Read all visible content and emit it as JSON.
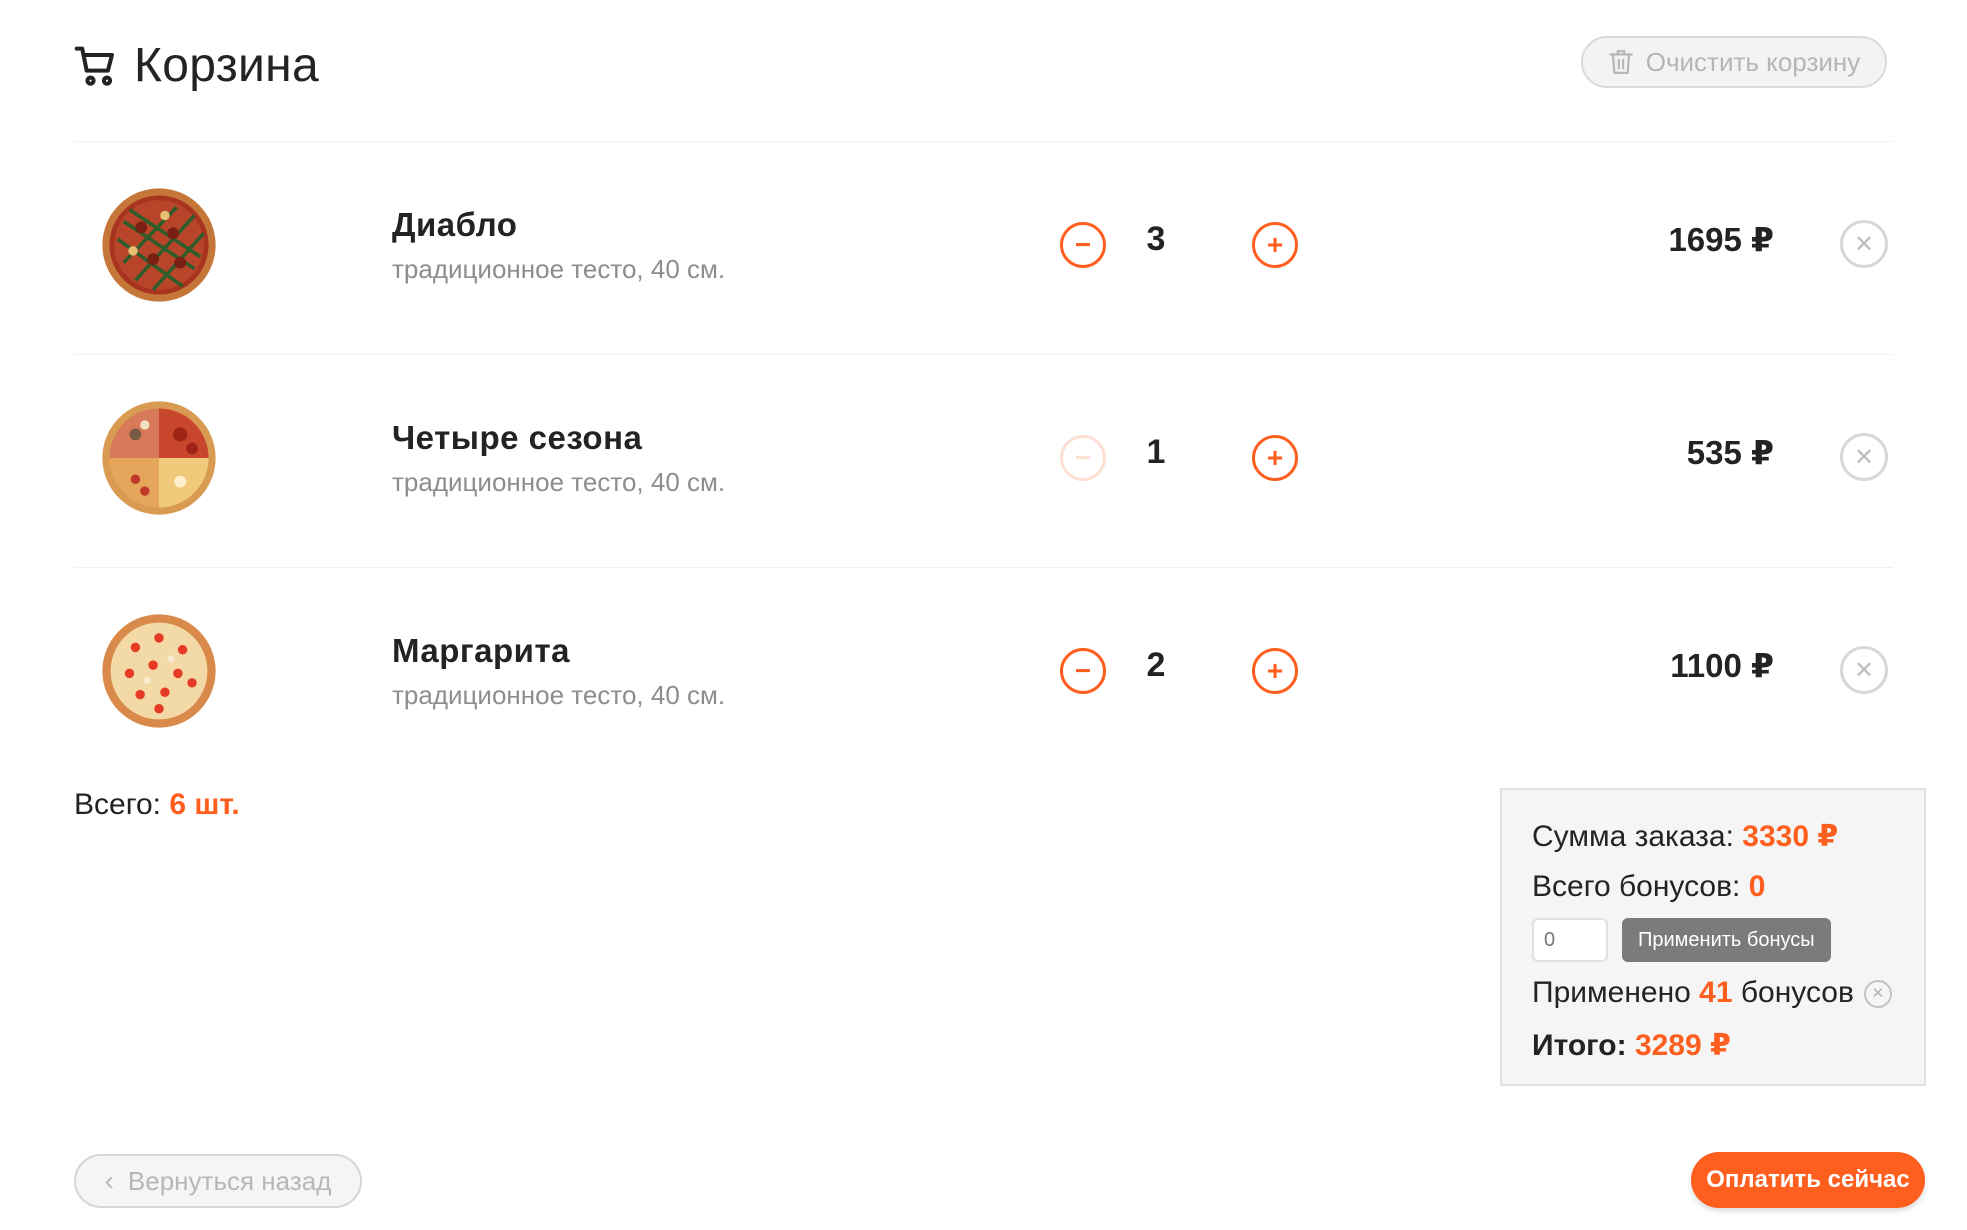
{
  "header": {
    "title": "Корзина",
    "clear_label": "Очистить корзину"
  },
  "items": [
    {
      "name": "Диабло",
      "desc": "традиционное тесто, 40 см.",
      "qty": "3",
      "price": "1695 ₽",
      "minus_enabled": true
    },
    {
      "name": "Четыре сезона",
      "desc": "традиционное тесто, 40 см.",
      "qty": "1",
      "price": "535 ₽",
      "minus_enabled": false
    },
    {
      "name": "Маргарита",
      "desc": "традиционное тесто, 40 см.",
      "qty": "2",
      "price": "1100 ₽",
      "minus_enabled": true
    }
  ],
  "controls": {
    "minus": "−",
    "plus": "+",
    "remove": "✕"
  },
  "totals": {
    "count_label": "Всего: ",
    "count_value": "6 шт."
  },
  "summary": {
    "sum_label": "Сумма заказа: ",
    "sum_value": "3330 ₽",
    "bonus_label": "Всего бонусов: ",
    "bonus_value": "0",
    "bonus_input_placeholder": "0",
    "apply_label": "Применить бонусы",
    "applied_prefix": "Применено ",
    "applied_value": "41",
    "applied_suffix": " бонусов",
    "final_label": "Итого: ",
    "final_value": "3289 ₽"
  },
  "footer": {
    "back_label": "Вернуться назад",
    "pay_label": "Оплатить сейчас"
  },
  "colors": {
    "accent": "#fe5f1e",
    "muted": "#8d8d8d",
    "text": "#232323"
  },
  "icons": [
    "cart-icon",
    "trash-icon",
    "pizza-image",
    "minus-icon",
    "plus-icon",
    "close-icon",
    "chevron-left-icon"
  ]
}
